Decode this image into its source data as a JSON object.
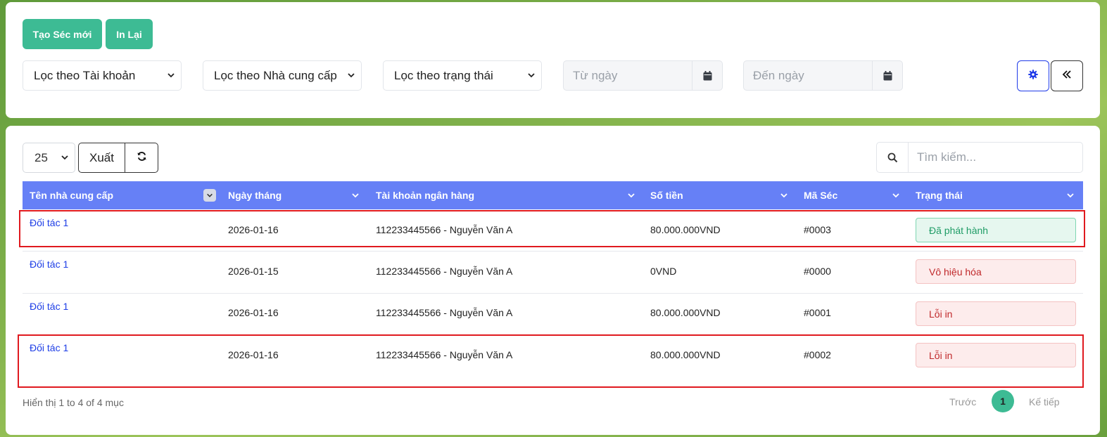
{
  "toolbar": {
    "create_label": "Tạo Séc mới",
    "reprint_label": "In Lại"
  },
  "filters": {
    "account": "Lọc theo Tài khoản",
    "supplier": "Lọc theo Nhà cung cấp",
    "status": "Lọc theo trạng thái",
    "from_date": "Từ ngày",
    "to_date": "Đến ngày"
  },
  "table_controls": {
    "page_size": "25",
    "export_label": "Xuất",
    "search_placeholder": "Tìm kiếm..."
  },
  "table": {
    "columns": [
      "Tên nhà cung cấp",
      "Ngày tháng",
      "Tài khoản ngân hàng",
      "Số tiền",
      "Mã Séc",
      "Trạng thái"
    ],
    "rows": [
      {
        "supplier": "Đối tác 1",
        "date": "2026-01-16",
        "account": "112233445566 - Nguyễn Văn A",
        "amount": "80.000.000VND",
        "code": "#0003",
        "status": "Đã phát hành"
      },
      {
        "supplier": "Đối tác 1",
        "date": "2026-01-15",
        "account": "112233445566 - Nguyễn Văn A",
        "amount": "0VND",
        "code": "#0000",
        "status": "Vô hiệu hóa"
      },
      {
        "supplier": "Đối tác 1",
        "date": "2026-01-16",
        "account": "112233445566 - Nguyễn Văn A",
        "amount": "80.000.000VND",
        "code": "#0001",
        "status": "Lỗi in"
      },
      {
        "supplier": "Đối tác 1",
        "date": "2026-01-16",
        "account": "112233445566 - Nguyễn Văn A",
        "amount": "80.000.000VND",
        "code": "#0002",
        "status": "Lỗi in"
      }
    ]
  },
  "footer": {
    "info": "Hiển thị 1 to 4 of 4 mục",
    "prev": "Trước",
    "page": "1",
    "next": "Kế tiếp"
  },
  "colors": {
    "accent_green": "#3dbb94",
    "header_blue": "#6680f6",
    "highlight_red": "#e0191f"
  },
  "icons": [
    "chevron-down-icon",
    "calendar-icon",
    "gear-icon",
    "double-chevron-left-icon",
    "refresh-icon",
    "search-icon"
  ]
}
